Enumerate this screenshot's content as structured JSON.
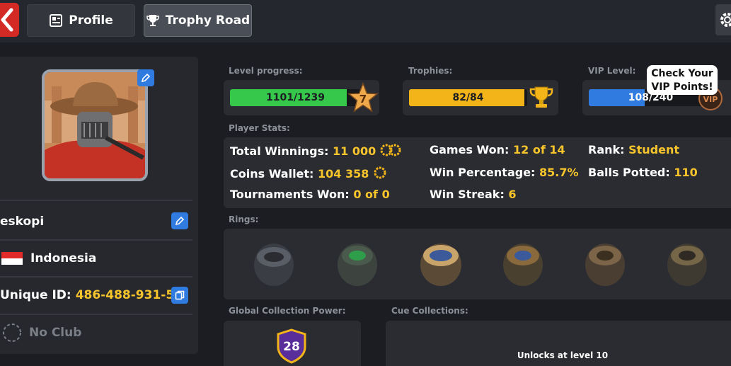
{
  "header": {
    "tabs": [
      {
        "label": "Profile",
        "icon": "profile-card-icon"
      },
      {
        "label": "Trophy Road",
        "icon": "trophy-icon"
      }
    ]
  },
  "profile": {
    "username": "eskopi",
    "country": "Indonesia",
    "unique_id_label": "Unique ID:",
    "unique_id": "486-488-931-5",
    "club": "No Club"
  },
  "level": {
    "label": "Level progress:",
    "text": "1101/1239",
    "fraction": 0.89,
    "badge": "7"
  },
  "trophies": {
    "label": "Trophies:",
    "text": "82/84",
    "fraction": 0.976
  },
  "vip": {
    "label": "VIP Level:",
    "text": "108/240",
    "fraction": 0.45,
    "badge": "VIP",
    "tooltip_line1": "Check Your",
    "tooltip_line2": "VIP Points!"
  },
  "stats": {
    "label": "Player Stats:",
    "total_winnings_label": "Total Winnings:",
    "total_winnings": "11 000",
    "coins_wallet_label": "Coins Wallet:",
    "coins_wallet": "104 358",
    "tournaments_won_label": "Tournaments Won:",
    "tournaments_won": "0 of 0",
    "games_won_label": "Games Won:",
    "games_won": "12 of 14",
    "win_percentage_label": "Win Percentage:",
    "win_percentage": "85.7%",
    "win_streak_label": "Win Streak:",
    "win_streak": "6",
    "rank_label": "Rank:",
    "rank": "Student",
    "balls_potted_label": "Balls Potted:",
    "balls_potted": "110"
  },
  "rings": {
    "label": "Rings:"
  },
  "collection": {
    "label": "Global Collection Power:",
    "value": "28"
  },
  "cues": {
    "label": "Cue Collections:",
    "unlock_text": "Unlocks at level 10"
  },
  "colors": {
    "accent_yellow": "#f7c52b",
    "level_green": "#35c84a",
    "trophy_yellow": "#f2b418",
    "vip_blue": "#2f7be0",
    "back_red": "#d42a26"
  }
}
